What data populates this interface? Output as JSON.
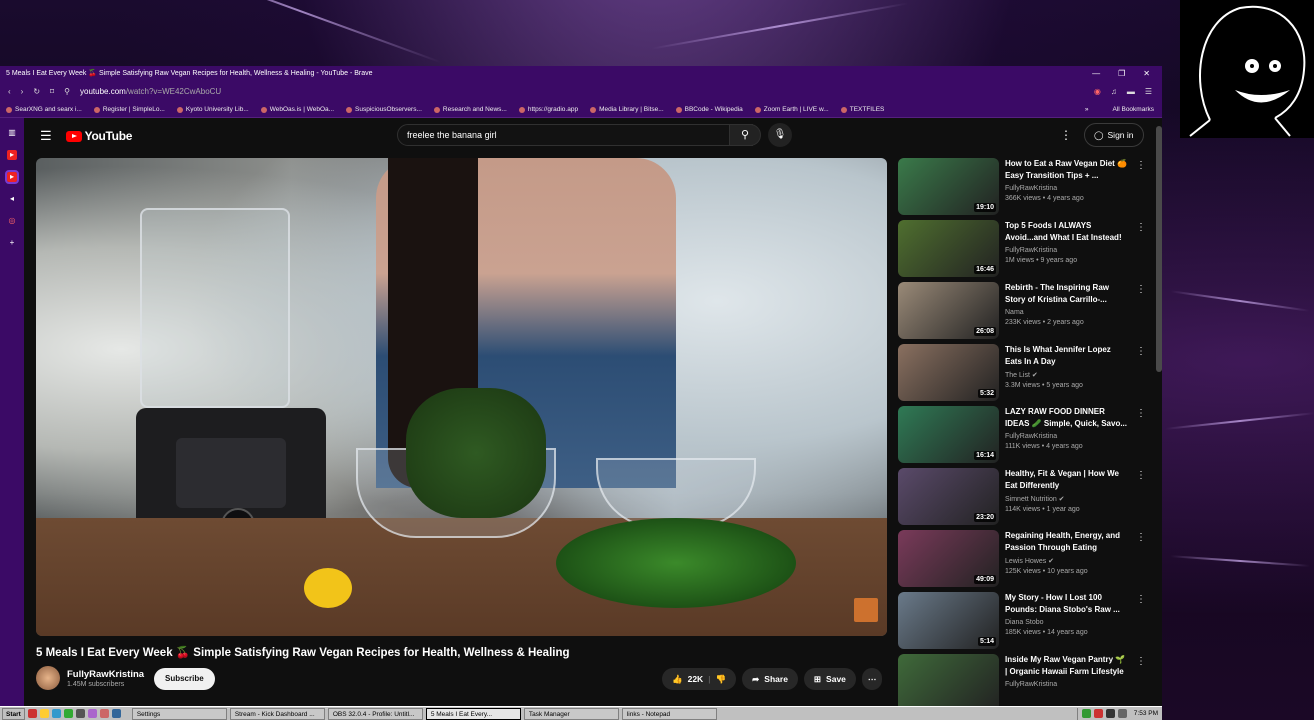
{
  "window": {
    "title": "5 Meals I Eat Every Week 🍒 Simple Satisfying Raw Vegan Recipes for Health, Wellness & Healing - YouTube - Brave"
  },
  "address": {
    "url_host": "youtube.com",
    "url_path": "/watch?v=WE42CwAboCU"
  },
  "bookmarks": [
    "SearXNG and searx i...",
    "Register | SimpleLo...",
    "Kyoto University Lib...",
    "WebOas.is | WebOa...",
    "SuspiciousObservers...",
    "Research and News...",
    "https://gradio.app",
    "Media Library | Bitse...",
    "BBCode - Wikipedia",
    "Zoom Earth | LIVE w...",
    "TEXTFILES"
  ],
  "bookmarks_more": "»",
  "all_bookmarks": "All Bookmarks",
  "youtube": {
    "logo_text": "YouTube",
    "search_value": "freelee the banana girl",
    "sign_in": "Sign in"
  },
  "video": {
    "title": "5 Meals I Eat Every Week 🍒 Simple Satisfying Raw Vegan Recipes for Health, Wellness & Healing",
    "channel": "FullyRawKristina",
    "subscribers": "1.45M subscribers",
    "subscribe": "Subscribe",
    "likes": "22K",
    "share": "Share",
    "save": "Save"
  },
  "recommendations": [
    {
      "title": "How to Eat a Raw Vegan Diet 🍊 Easy Transition Tips + ...",
      "channel": "FullyRawKristina",
      "meta": "366K views • 4 years ago",
      "duration": "19:10",
      "color": "#3a7a4a"
    },
    {
      "title": "Top 5 Foods I ALWAYS Avoid...and What I Eat Instead!",
      "channel": "FullyRawKristina",
      "meta": "1M views • 9 years ago",
      "duration": "16:46",
      "color": "#4f6f2f"
    },
    {
      "title": "Rebirth - The Inspiring Raw Story of Kristina Carrillo-...",
      "channel": "Nama",
      "meta": "233K views • 2 years ago",
      "duration": "26:08",
      "color": "#9a8a78"
    },
    {
      "title": "This Is What Jennifer Lopez Eats In A Day",
      "channel": "The List ✔",
      "meta": "3.3M views • 5 years ago",
      "duration": "5:32",
      "color": "#8a7060"
    },
    {
      "title": "LAZY RAW FOOD DINNER IDEAS 🥒 Simple, Quick, Savo...",
      "channel": "FullyRawKristina",
      "meta": "111K views • 4 years ago",
      "duration": "16:14",
      "color": "#2f7a55"
    },
    {
      "title": "Healthy, Fit & Vegan | How We Eat Differently",
      "channel": "Simnett Nutrition ✔",
      "meta": "114K views • 1 year ago",
      "duration": "23:20",
      "color": "#5a4a6a"
    },
    {
      "title": "Regaining Health, Energy, and Passion Through Eating Plants...",
      "channel": "Lewis Howes ✔",
      "meta": "125K views • 10 years ago",
      "duration": "49:09",
      "color": "#7a3a5a"
    },
    {
      "title": "My Story - How I Lost 100 Pounds: Diana Stobo's Raw ...",
      "channel": "Diana Stobo",
      "meta": "185K views • 14 years ago",
      "duration": "5:14",
      "color": "#6a7a8a"
    },
    {
      "title": "Inside My Raw Vegan Pantry 🌱 | Organic Hawaii Farm Lifestyle",
      "channel": "FullyRawKristina",
      "meta": "",
      "duration": "",
      "color": "#3f6a3a"
    }
  ],
  "taskbar": {
    "start": "Start",
    "tasks": [
      "Settings",
      "Stream - Kick Dashboard ...",
      "OBS 32.0.4 - Profile: Untitl...",
      "5 Meals I Eat Every...",
      "Task Manager",
      "links - Notepad"
    ],
    "clock": "7:53 PM"
  }
}
